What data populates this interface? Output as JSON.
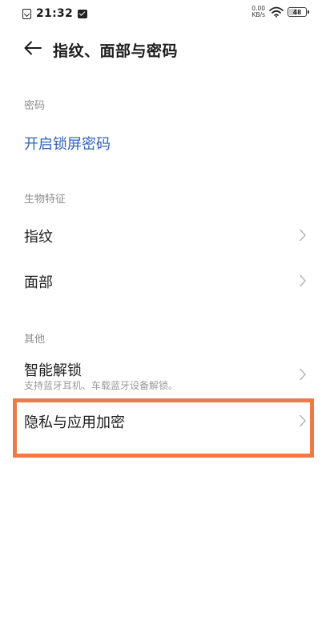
{
  "status_bar": {
    "time": "21:32",
    "net_speed_value": "0.00",
    "net_speed_unit": "KB/s",
    "battery": "48",
    "battery_fraction": 0.48
  },
  "header": {
    "title": "指纹、面部与密码"
  },
  "sections": {
    "password": {
      "header": "密码",
      "enable_lock_password": "开启锁屏密码"
    },
    "biometrics": {
      "header": "生物特征",
      "fingerprint": "指纹",
      "face": "面部"
    },
    "other": {
      "header": "其他",
      "smart_unlock": "智能解锁",
      "smart_unlock_sub": "支持蓝牙耳机、车载蓝牙设备解锁。",
      "privacy_encryption": "隐私与应用加密"
    }
  },
  "colors": {
    "link": "#2f63b8",
    "highlight": "#ee7a48",
    "section_header": "#8c8c8c"
  }
}
